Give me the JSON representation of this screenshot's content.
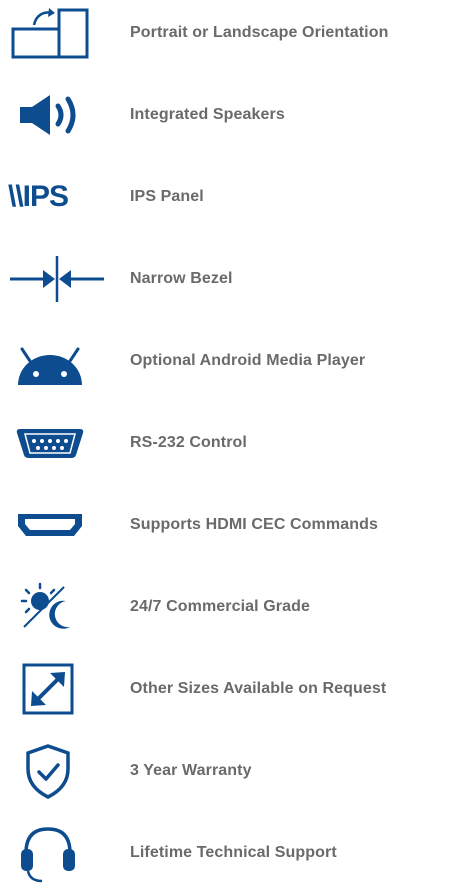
{
  "features": [
    {
      "icon": "rotate-orientation-icon",
      "label": "Portrait or Landscape Orientation"
    },
    {
      "icon": "speaker-icon",
      "label": "Integrated Speakers"
    },
    {
      "icon": "ips-panel-icon",
      "label": "IPS Panel",
      "icon_text": "\\\\IPS"
    },
    {
      "icon": "narrow-bezel-icon",
      "label": "Narrow Bezel"
    },
    {
      "icon": "android-icon",
      "label": "Optional Android Media Player"
    },
    {
      "icon": "serial-port-icon",
      "label": "RS-232 Control"
    },
    {
      "icon": "hdmi-port-icon",
      "label": "Supports HDMI CEC Commands"
    },
    {
      "icon": "day-night-icon",
      "label": "24/7 Commercial Grade"
    },
    {
      "icon": "resize-icon",
      "label": "Other Sizes Available on Request"
    },
    {
      "icon": "shield-check-icon",
      "label": "3 Year Warranty"
    },
    {
      "icon": "headset-icon",
      "label": "Lifetime Technical Support"
    }
  ],
  "colors": {
    "icon_blue": "#0d4c8f",
    "text_gray": "#6a6a6a",
    "background": "#ffffff"
  }
}
